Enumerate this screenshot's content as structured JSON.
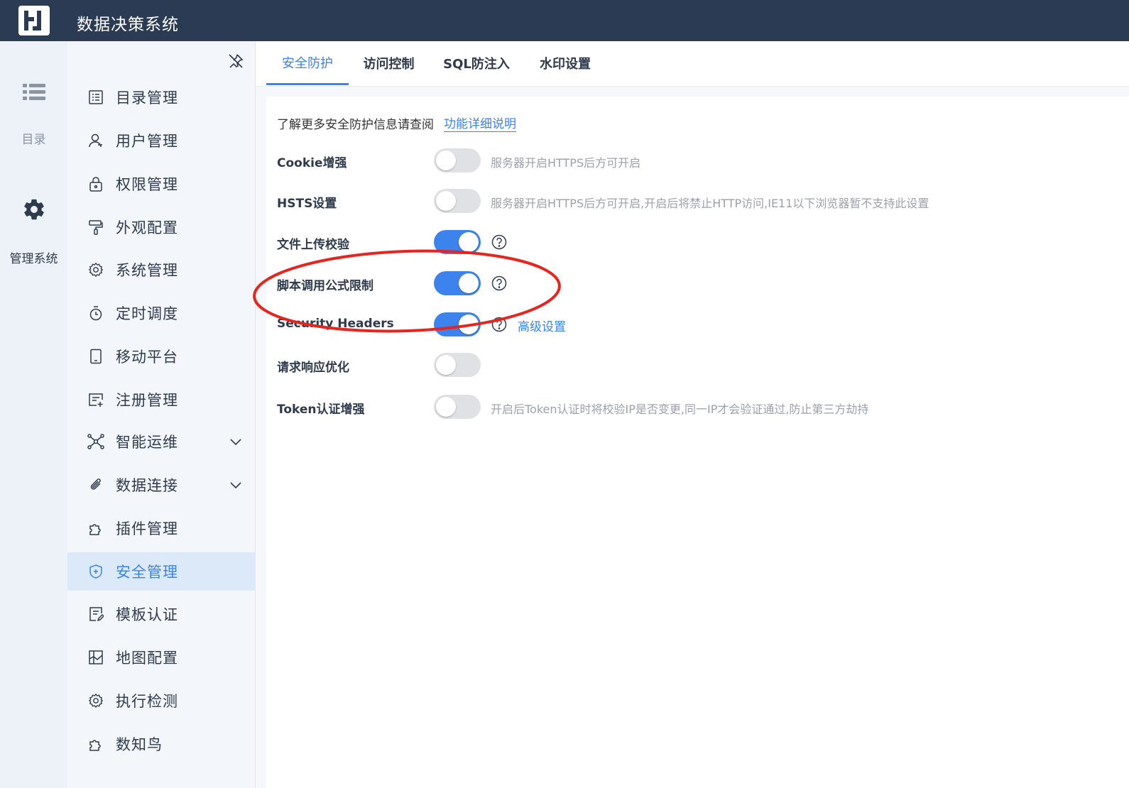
{
  "header": {
    "title": "数据决策系统"
  },
  "rail": {
    "items": [
      {
        "label": "目录",
        "icon": "list-icon"
      },
      {
        "label": "管理系统",
        "icon": "gear-icon"
      }
    ]
  },
  "sidebar": {
    "items": [
      {
        "label": "目录管理",
        "icon": "catalog-icon"
      },
      {
        "label": "用户管理",
        "icon": "user-icon"
      },
      {
        "label": "权限管理",
        "icon": "lock-icon"
      },
      {
        "label": "外观配置",
        "icon": "paint-roller-icon"
      },
      {
        "label": "系统管理",
        "icon": "settings-icon"
      },
      {
        "label": "定时调度",
        "icon": "timer-icon"
      },
      {
        "label": "移动平台",
        "icon": "mobile-icon"
      },
      {
        "label": "注册管理",
        "icon": "register-icon"
      },
      {
        "label": "智能运维",
        "icon": "network-icon"
      },
      {
        "label": "数据连接",
        "icon": "paperclip-icon"
      },
      {
        "label": "插件管理",
        "icon": "puzzle-icon"
      },
      {
        "label": "安全管理",
        "icon": "shield-icon"
      },
      {
        "label": "模板认证",
        "icon": "template-icon"
      },
      {
        "label": "地图配置",
        "icon": "map-icon"
      },
      {
        "label": "执行检测",
        "icon": "settings-icon"
      },
      {
        "label": "数知鸟",
        "icon": "puzzle-icon"
      }
    ],
    "active_index": 11
  },
  "tabs": [
    {
      "label": "安全防护"
    },
    {
      "label": "访问控制"
    },
    {
      "label": "SQL防注入"
    },
    {
      "label": "水印设置"
    }
  ],
  "content": {
    "info_text": "了解更多安全防护信息请查阅",
    "info_link": "功能详细说明",
    "settings": [
      {
        "label": "Cookie增强",
        "enabled": false,
        "description": "服务器开启HTTPS后方可开启"
      },
      {
        "label": "HSTS设置",
        "enabled": false,
        "description": "服务器开启HTTPS后方可开启,开启后将禁止HTTP访问,IE11以下浏览器暂不支持此设置"
      },
      {
        "label": "文件上传校验",
        "enabled": true,
        "description": ""
      },
      {
        "label": "脚本调用公式限制",
        "enabled": true,
        "description": ""
      },
      {
        "label": "Security Headers",
        "enabled": true,
        "description": "",
        "link": "高级设置"
      },
      {
        "label": "请求响应优化",
        "enabled": false,
        "description": ""
      },
      {
        "label": "Token认证增强",
        "enabled": false,
        "description": "开启后Token认证时将校验IP是否变更,同一IP才会验证通过,防止第三方劫持"
      }
    ]
  },
  "colors": {
    "header_bg": "#2c3b54",
    "accent": "#3a83e8",
    "switch_on": "#3d83ed",
    "switch_off": "#dfe1e5",
    "annotation": "#e8241f"
  }
}
